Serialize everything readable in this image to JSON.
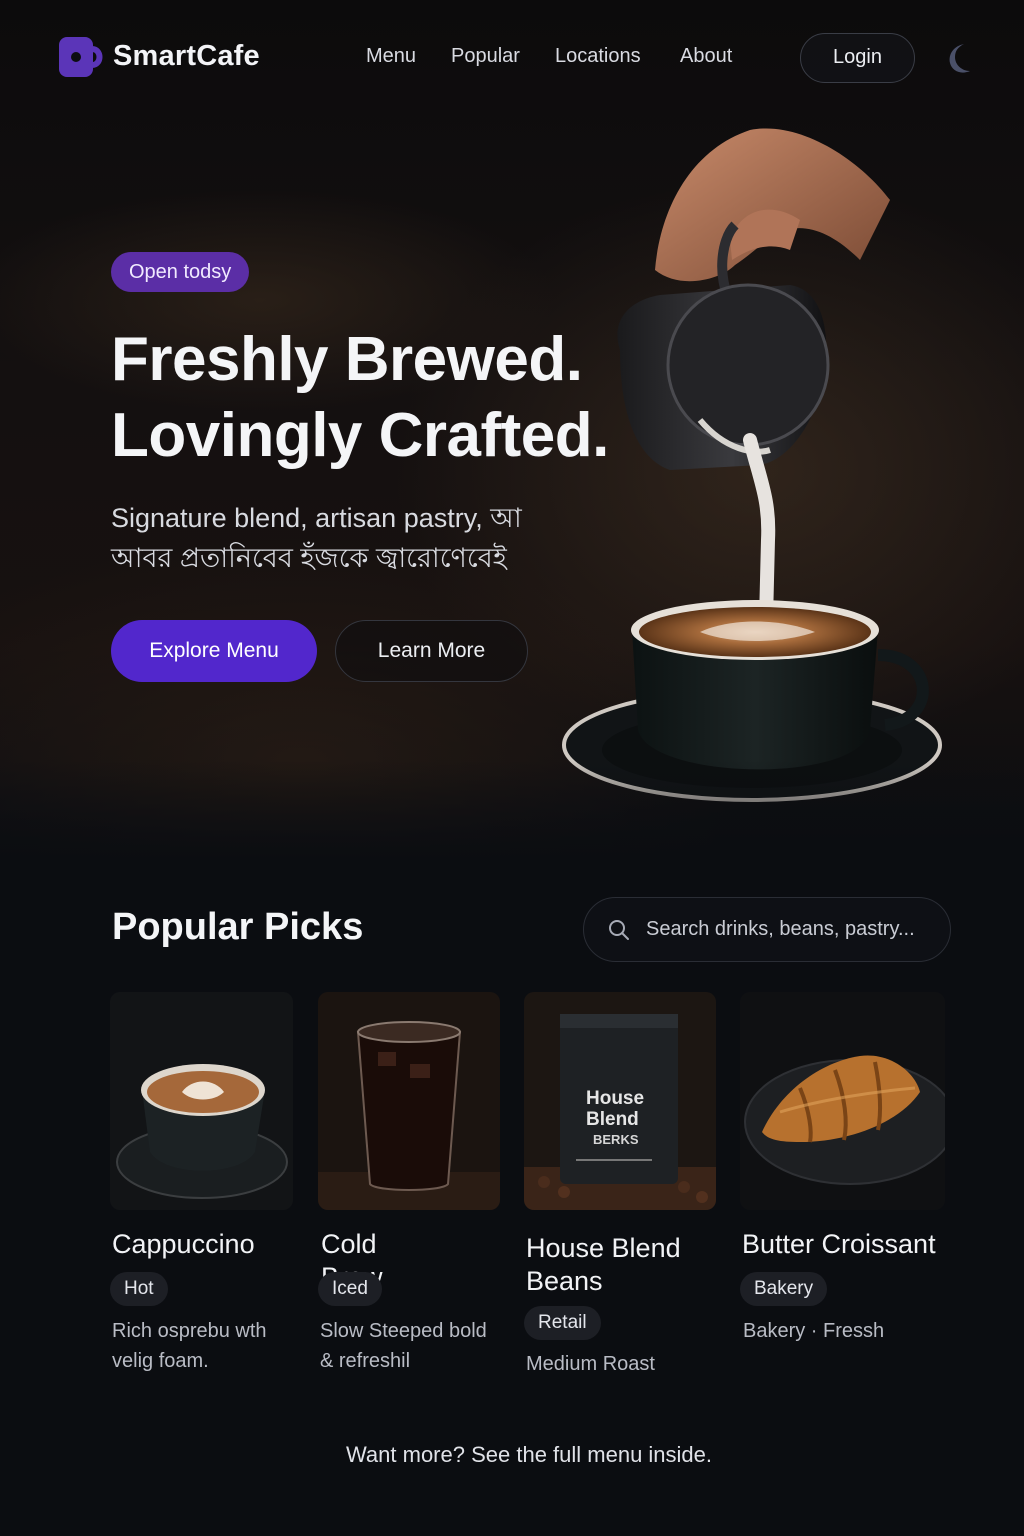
{
  "brand": {
    "name": "SmartCafe",
    "accent": "#5227cc",
    "badge_color": "#5b2ea6"
  },
  "nav": {
    "links": [
      "Menu",
      "Popular",
      "Locations",
      "About"
    ],
    "login_label": "Login",
    "theme_icon": "moon-icon"
  },
  "hero": {
    "badge": "Open todsy",
    "headline_line1": "Freshly Brewed.",
    "headline_line2": "Lovingly Crafted.",
    "subtext": "Signature blend, artisan pastry, আ আবর প্রতানিবেব হঁজকে জ্বারোণেবেই",
    "primary_cta": "Explore Menu",
    "secondary_cta": "Learn More"
  },
  "popular": {
    "title": "Popular Picks",
    "search_placeholder": "Search drinks, beans, pastry...",
    "items": [
      {
        "name": "Cappuccino",
        "tag": "Hot",
        "desc": "Rich osprebu wth velig foam."
      },
      {
        "name": "Cold Brew",
        "tag": "Iced",
        "desc": "Slow Steeped bold & refreshil"
      },
      {
        "name": "House Blend Beans",
        "tag": "Retail",
        "desc": "Medium Roast",
        "bag_label_1": "House",
        "bag_label_2": "Blend",
        "bag_label_3": "BERKS"
      },
      {
        "name": "Butter Croissant",
        "tag": "Bakery",
        "desc": "Bakery · Fressh"
      }
    ]
  },
  "footer": {
    "note": "Want more? See the full menu inside."
  }
}
